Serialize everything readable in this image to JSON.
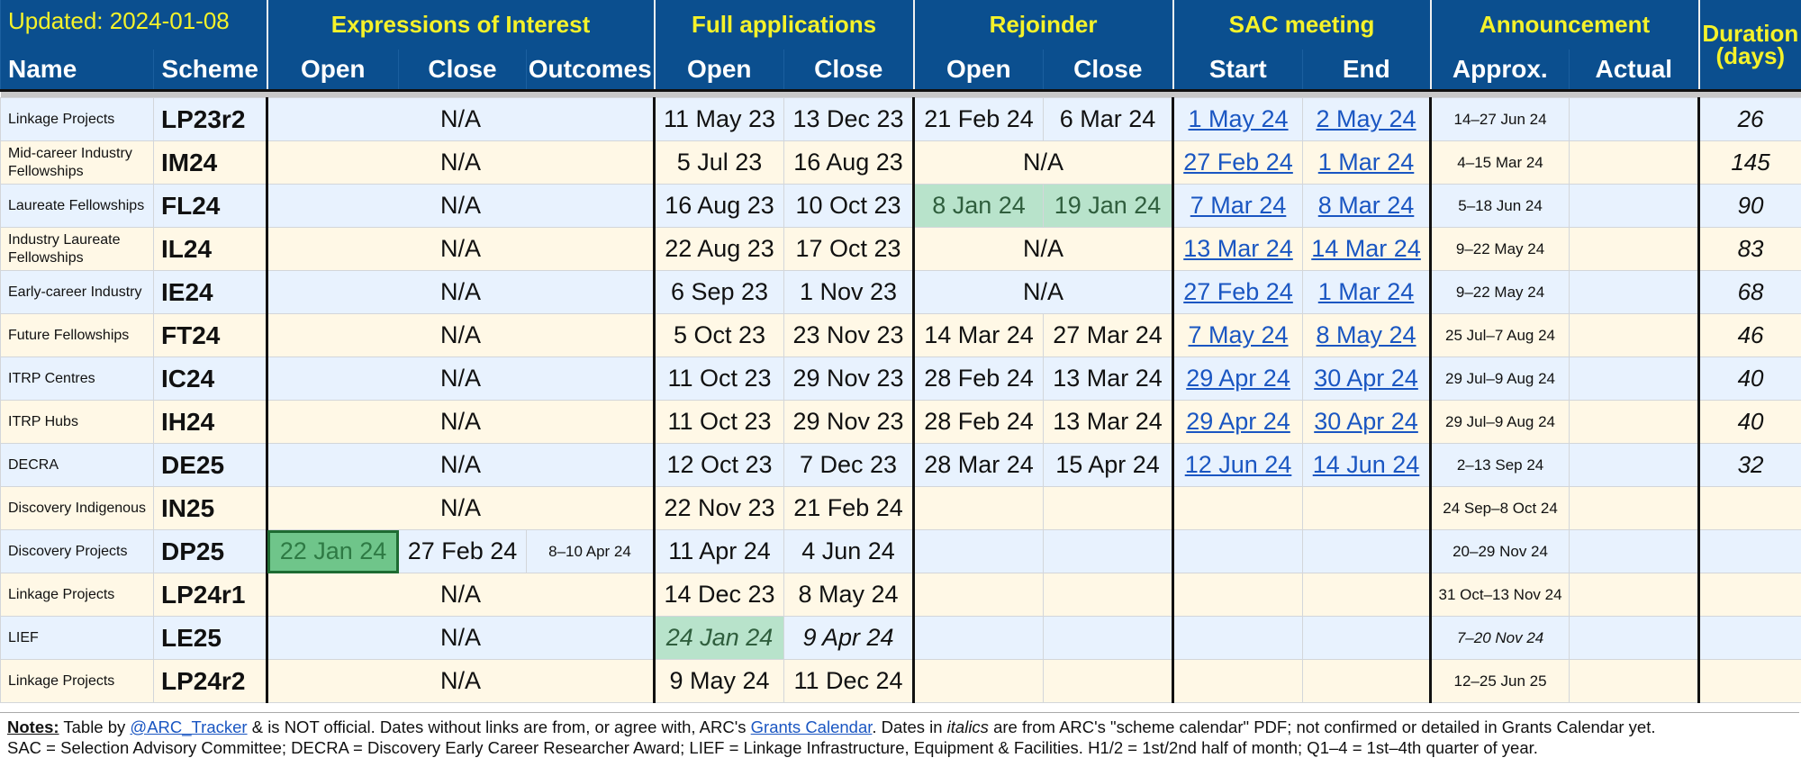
{
  "header": {
    "updated": "Updated: 2024-01-08",
    "groups": {
      "eoi": "Expressions of Interest",
      "full_applications": "Full applications",
      "rejoinder": "Rejoinder",
      "sac_meeting": "SAC meeting",
      "announcement": "Announcement",
      "duration": "Duration (days)"
    },
    "columns": {
      "name": "Name",
      "scheme": "Scheme",
      "eoi_open": "Open",
      "eoi_close": "Close",
      "eoi_outcomes": "Outcomes",
      "fa_open": "Open",
      "fa_close": "Close",
      "rej_open": "Open",
      "rej_close": "Close",
      "sac_start": "Start",
      "sac_end": "End",
      "ann_approx": "Approx.",
      "ann_actual": "Actual"
    }
  },
  "rows": [
    {
      "name": "Linkage Projects",
      "scheme": "LP23r2",
      "eoi": "N/A",
      "fa_open": "11 May 23",
      "fa_close": "13 Dec 23",
      "rej_open": "21 Feb 24",
      "rej_close": "6 Mar 24",
      "sac_start": "1 May 24",
      "sac_end": "2 May 24",
      "ann_approx": "14–27 Jun 24",
      "ann_actual": "",
      "duration": "26"
    },
    {
      "name": "Mid-career Industry Fellowships",
      "scheme": "IM24",
      "eoi": "N/A",
      "fa_open": "5 Jul 23",
      "fa_close": "16 Aug 23",
      "rejoinder": "N/A",
      "sac_start": "27 Feb 24",
      "sac_end": "1 Mar 24",
      "ann_approx": "4–15 Mar 24",
      "ann_actual": "",
      "duration": "145"
    },
    {
      "name": "Laureate Fellowships",
      "scheme": "FL24",
      "eoi": "N/A",
      "fa_open": "16 Aug 23",
      "fa_close": "10 Oct 23",
      "rej_open": "8 Jan 24",
      "rej_close": "19 Jan 24",
      "sac_start": "7 Mar 24",
      "sac_end": "8 Mar 24",
      "ann_approx": "5–18 Jun 24",
      "ann_actual": "",
      "duration": "90"
    },
    {
      "name": "Industry Laureate Fellowships",
      "scheme": "IL24",
      "eoi": "N/A",
      "fa_open": "22 Aug 23",
      "fa_close": "17 Oct 23",
      "rejoinder": "N/A",
      "sac_start": "13 Mar 24",
      "sac_end": "14 Mar 24",
      "ann_approx": "9–22 May 24",
      "ann_actual": "",
      "duration": "83"
    },
    {
      "name": "Early-career Industry",
      "scheme": "IE24",
      "eoi": "N/A",
      "fa_open": "6 Sep 23",
      "fa_close": "1 Nov 23",
      "rejoinder": "N/A",
      "sac_start": "27 Feb 24",
      "sac_end": "1 Mar 24",
      "ann_approx": "9–22 May 24",
      "ann_actual": "",
      "duration": "68"
    },
    {
      "name": "Future Fellowships",
      "scheme": "FT24",
      "eoi": "N/A",
      "fa_open": "5 Oct 23",
      "fa_close": "23 Nov 23",
      "rej_open": "14 Mar 24",
      "rej_close": "27 Mar 24",
      "sac_start": "7 May 24",
      "sac_end": "8 May 24",
      "ann_approx": "25 Jul–7 Aug 24",
      "ann_actual": "",
      "duration": "46"
    },
    {
      "name": "ITRP Centres",
      "scheme": "IC24",
      "eoi": "N/A",
      "fa_open": "11 Oct 23",
      "fa_close": "29 Nov 23",
      "rej_open": "28 Feb 24",
      "rej_close": "13 Mar 24",
      "sac_start": "29 Apr 24",
      "sac_end": "30 Apr 24",
      "ann_approx": "29 Jul–9 Aug 24",
      "ann_actual": "",
      "duration": "40"
    },
    {
      "name": "ITRP Hubs",
      "scheme": "IH24",
      "eoi": "N/A",
      "fa_open": "11 Oct 23",
      "fa_close": "29 Nov 23",
      "rej_open": "28 Feb 24",
      "rej_close": "13 Mar 24",
      "sac_start": "29 Apr 24",
      "sac_end": "30 Apr 24",
      "ann_approx": "29 Jul–9 Aug 24",
      "ann_actual": "",
      "duration": "40"
    },
    {
      "name": "DECRA",
      "scheme": "DE25",
      "eoi": "N/A",
      "fa_open": "12 Oct 23",
      "fa_close": "7 Dec 23",
      "rej_open": "28 Mar 24",
      "rej_close": "15 Apr 24",
      "sac_start": "12 Jun 24",
      "sac_end": "14 Jun 24",
      "ann_approx": "2–13 Sep 24",
      "ann_actual": "",
      "duration": "32"
    },
    {
      "name": "Discovery Indigenous",
      "scheme": "IN25",
      "eoi": "N/A",
      "fa_open": "22 Nov 23",
      "fa_close": "21 Feb 24",
      "rej_open": "",
      "rej_close": "",
      "sac_start": "",
      "sac_end": "",
      "ann_approx": "24 Sep–8 Oct 24",
      "ann_actual": "",
      "duration": ""
    },
    {
      "name": "Discovery Projects",
      "scheme": "DP25",
      "eoi_open": "22 Jan 24",
      "eoi_close": "27 Feb 24",
      "eoi_outcomes": "8–10 Apr 24",
      "fa_open": "11 Apr 24",
      "fa_close": "4 Jun 24",
      "rej_open": "",
      "rej_close": "",
      "sac_start": "",
      "sac_end": "",
      "ann_approx": "20–29 Nov 24",
      "ann_actual": "",
      "duration": ""
    },
    {
      "name": "Linkage Projects",
      "scheme": "LP24r1",
      "eoi": "N/A",
      "fa_open": "14 Dec 23",
      "fa_close": "8 May 24",
      "rej_open": "",
      "rej_close": "",
      "sac_start": "",
      "sac_end": "",
      "ann_approx": "31 Oct–13 Nov 24",
      "ann_actual": "",
      "duration": ""
    },
    {
      "name": "LIEF",
      "scheme": "LE25",
      "eoi": "N/A",
      "fa_open": "24 Jan 24",
      "fa_close": "9 Apr 24",
      "rej_open": "",
      "rej_close": "",
      "sac_start": "",
      "sac_end": "",
      "ann_approx": "7–20 Nov 24",
      "ann_actual": "",
      "duration": ""
    },
    {
      "name": "Linkage Projects",
      "scheme": "LP24r2",
      "eoi": "N/A",
      "fa_open": "9 May 24",
      "fa_close": "11 Dec 24",
      "rej_open": "",
      "rej_close": "",
      "sac_start": "",
      "sac_end": "",
      "ann_approx": "12–25 Jun 25",
      "ann_actual": "",
      "duration": ""
    }
  ],
  "notes": {
    "label": "Notes:",
    "t1": " Table by ",
    "link1": "@ARC_Tracker",
    "t2": " & is NOT official. Dates without links are from, or agree with, ARC's ",
    "link2": "Grants Calendar",
    "t3": ". Dates in ",
    "t3_italic": "italics",
    "t4": " are from ARC's \"scheme calendar\" PDF; not confirmed or detailed in Grants Calendar yet.",
    "line2": "SAC = Selection Advisory Committee; DECRA = Discovery Early Career Researcher Award; LIEF = Linkage Infrastructure, Equipment & Facilities. H1/2 = 1st/2nd half of month; Q1–4 = 1st–4th quarter of year."
  },
  "colors": {
    "header_bg": "#0b4f8f",
    "group_title": "#f5f22a",
    "row_blue": "#e8f2fe",
    "row_cream": "#fff8e6",
    "link": "#1a56c2",
    "highlight_green": "#b8e3cb",
    "selected_green": "#6fc58a"
  }
}
